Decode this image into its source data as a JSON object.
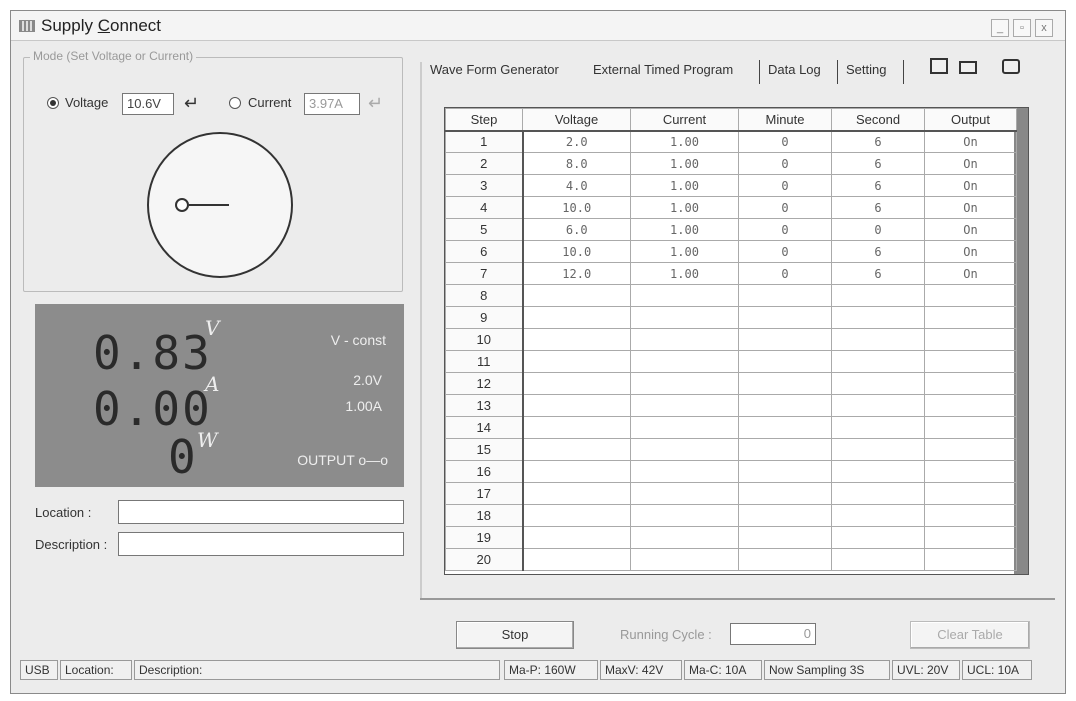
{
  "window": {
    "title_pre": "Supply ",
    "title_underlined": "C",
    "title_post": "onnect",
    "min_label": "_",
    "max_label": "▫",
    "close_label": "x"
  },
  "mode": {
    "legend": "Mode (Set Voltage or Current)",
    "voltage_label": "Voltage",
    "voltage_value": "10.6V",
    "voltage_selected": true,
    "current_label": "Current",
    "current_value": "3.97A"
  },
  "display": {
    "voltage_reading": "0.83",
    "voltage_unit": "V",
    "current_reading": "0.00",
    "current_unit": "A",
    "power_reading": "0",
    "power_unit": "W",
    "mode_status": "V - const",
    "set_voltage": "2.0V",
    "set_current": "1.00A",
    "output_status": "OUTPUT o—o"
  },
  "fields": {
    "location_label": "Location :",
    "location_value": "",
    "description_label": "Description :",
    "description_value": ""
  },
  "tabs": [
    {
      "label": "Wave Form Generator"
    },
    {
      "label": "External Timed Program"
    },
    {
      "label": "Data Log"
    },
    {
      "label": "Setting"
    }
  ],
  "table": {
    "headers": [
      "Step",
      "Voltage",
      "Current",
      "Minute",
      "Second",
      "Output"
    ],
    "rows": [
      [
        "1",
        "2.0",
        "1.00",
        "0",
        "6",
        "On"
      ],
      [
        "2",
        "8.0",
        "1.00",
        "0",
        "6",
        "On"
      ],
      [
        "3",
        "4.0",
        "1.00",
        "0",
        "6",
        "On"
      ],
      [
        "4",
        "10.0",
        "1.00",
        "0",
        "6",
        "On"
      ],
      [
        "5",
        "6.0",
        "1.00",
        "0",
        "0",
        "On"
      ],
      [
        "6",
        "10.0",
        "1.00",
        "0",
        "6",
        "On"
      ],
      [
        "7",
        "12.0",
        "1.00",
        "0",
        "6",
        "On"
      ],
      [
        "8",
        "",
        "",
        "",
        "",
        ""
      ],
      [
        "9",
        "",
        "",
        "",
        "",
        ""
      ],
      [
        "10",
        "",
        "",
        "",
        "",
        ""
      ],
      [
        "11",
        "",
        "",
        "",
        "",
        ""
      ],
      [
        "12",
        "",
        "",
        "",
        "",
        ""
      ],
      [
        "13",
        "",
        "",
        "",
        "",
        ""
      ],
      [
        "14",
        "",
        "",
        "",
        "",
        ""
      ],
      [
        "15",
        "",
        "",
        "",
        "",
        ""
      ],
      [
        "16",
        "",
        "",
        "",
        "",
        ""
      ],
      [
        "17",
        "",
        "",
        "",
        "",
        ""
      ],
      [
        "18",
        "",
        "",
        "",
        "",
        ""
      ],
      [
        "19",
        "",
        "",
        "",
        "",
        ""
      ],
      [
        "20",
        "",
        "",
        "",
        "",
        ""
      ]
    ]
  },
  "controls": {
    "stop_label": "Stop",
    "running_cycle_label": "Running Cycle :",
    "running_cycle_value": "0",
    "clear_table_label": "Clear Table"
  },
  "statusbar": {
    "connection": "USB",
    "location": "Location:",
    "description": "Description:",
    "max_power": "Ma-P: 160W",
    "max_voltage": "MaxV: 42V",
    "max_current": "Ma-C: 10A",
    "sampling": "Now Sampling 3S",
    "uvl": "UVL: 20V",
    "ucl": "UCL: 10A"
  }
}
